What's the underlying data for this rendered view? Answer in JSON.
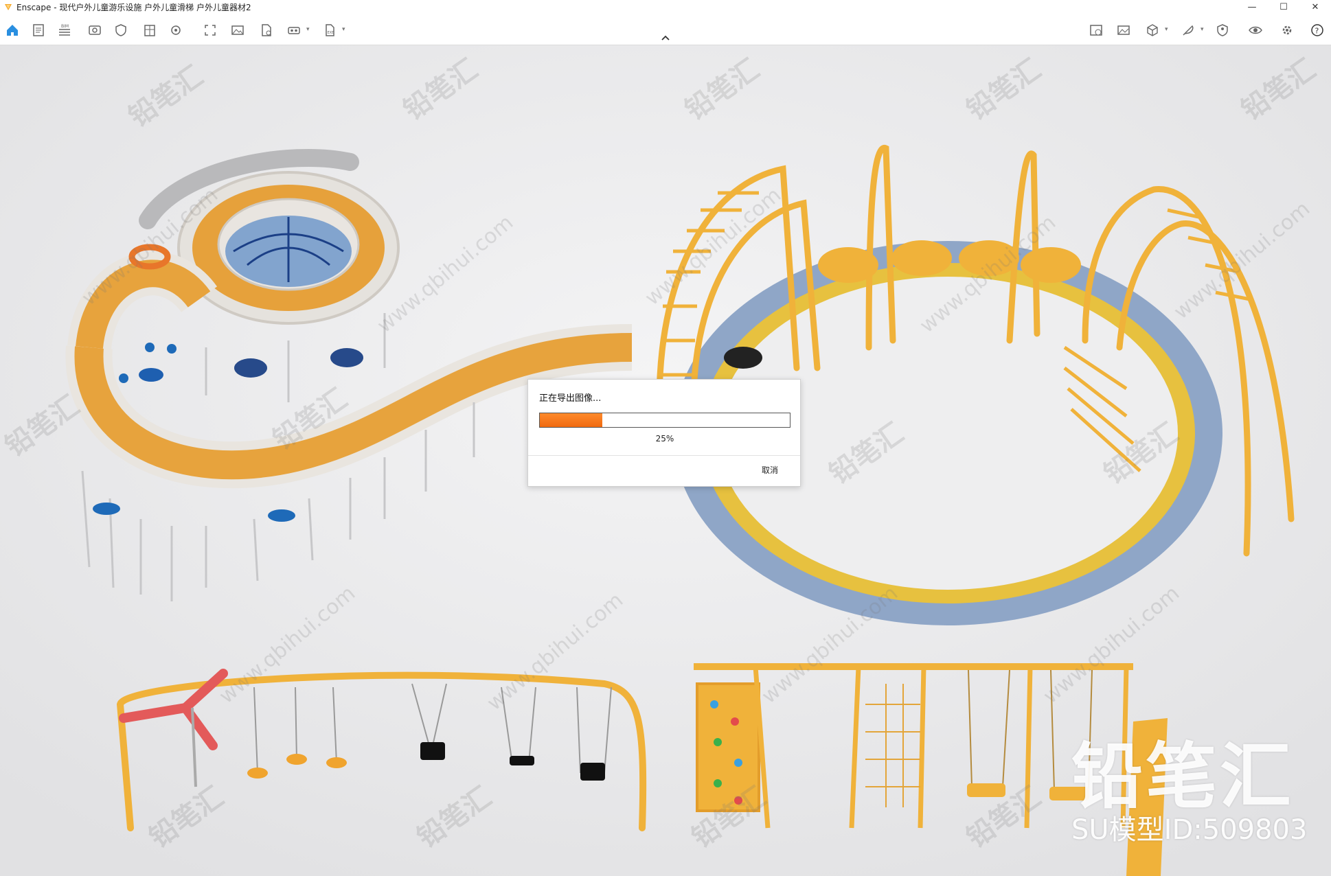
{
  "app": {
    "title": "Enscape - 现代户外儿童游乐设施 户外儿童滑梯 户外儿童器材2",
    "accent": "#f5a623"
  },
  "window_controls": {
    "minimize": "—",
    "maximize": "☐",
    "close": "✕"
  },
  "toolbar": {
    "left_icons": [
      "home-icon",
      "document-icon",
      "bim-icon",
      "eye-icon",
      "shield-icon",
      "building-icon",
      "settings-icon",
      "expand-icon",
      "image-icon",
      "file-export-icon",
      "vr-icon",
      "export-icon"
    ],
    "right_icons": [
      "image-check-icon",
      "image-icon",
      "cube-icon",
      "feather-icon",
      "shield-person-icon",
      "eye-icon",
      "gear-icon",
      "help-icon"
    ],
    "bim_label": "BIM"
  },
  "dialog": {
    "title": "正在导出图像...",
    "progress_percent": 25,
    "progress_text": "25%",
    "cancel_label": "取消"
  },
  "watermark": {
    "brand": "铅笔汇",
    "url": "www.qbihui.com",
    "brand_large": "铅笔汇",
    "model_id": "SU模型ID:509803"
  }
}
